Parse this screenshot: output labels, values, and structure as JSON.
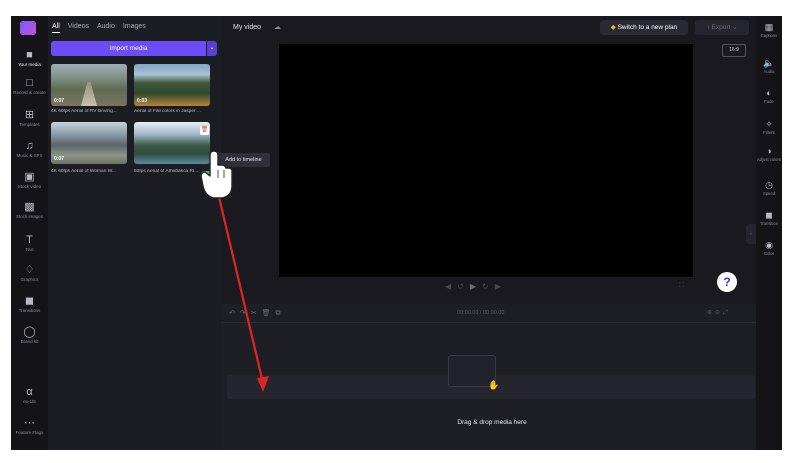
{
  "media_panel": {
    "tabs": [
      "All",
      "Videos",
      "Audio",
      "Images"
    ],
    "import_label": "Import media",
    "items": [
      {
        "duration": "0:07",
        "caption": "4K 60fps Aerial of RV Driving..."
      },
      {
        "duration": "0:03",
        "caption": "Aerial of Fall colors in Jasper ..."
      },
      {
        "duration": "0:07",
        "caption": "4K 60fps Aerial of Woman W..."
      },
      {
        "duration": "",
        "caption": "60fps Aerial of Athabasca Ri..."
      }
    ],
    "tooltip": "Add to timeline"
  },
  "left_rail": [
    {
      "icon": "folder-icon",
      "label": "Your media"
    },
    {
      "icon": "camera-icon",
      "label": "Record & create"
    },
    {
      "icon": "templates-icon",
      "label": "Templates"
    },
    {
      "icon": "music-icon",
      "label": "Music & SFX"
    },
    {
      "icon": "film-icon",
      "label": "Stock video"
    },
    {
      "icon": "image-icon",
      "label": "Stock images"
    },
    {
      "icon": "text-icon",
      "label": "Text"
    },
    {
      "icon": "shapes-icon",
      "label": "Graphics"
    },
    {
      "icon": "transition-icon",
      "label": "Transitions"
    },
    {
      "icon": "brand-icon",
      "label": "Brand kit"
    },
    {
      "icon": "language-icon",
      "label": "en-US"
    },
    {
      "icon": "more-icon",
      "label": "Feature Flags"
    }
  ],
  "header": {
    "title": "My video",
    "switch_plan_label": "Switch to a new plan",
    "export_label": "Export"
  },
  "preview": {
    "aspect_ratio": "16:9"
  },
  "timeline": {
    "time": "00:00.00 / 00:00.00",
    "drop_hint": "Drag & drop media here"
  },
  "right_rail": [
    {
      "icon": "captions-icon",
      "label": "Captions"
    },
    {
      "icon": "audio-icon",
      "label": "Audio"
    },
    {
      "icon": "fade-icon",
      "label": "Fade"
    },
    {
      "icon": "filters-icon",
      "label": "Filters"
    },
    {
      "icon": "adjust-icon",
      "label": "Adjust colors"
    },
    {
      "icon": "speed-icon",
      "label": "Speed"
    },
    {
      "icon": "transition-icon",
      "label": "Transition"
    },
    {
      "icon": "color-icon",
      "label": "Color"
    }
  ],
  "colors": {
    "accent": "#6b4cf5",
    "help_blue": "#2a3cd8",
    "arrow_red": "#e02424",
    "add_green": "#4db87a"
  }
}
